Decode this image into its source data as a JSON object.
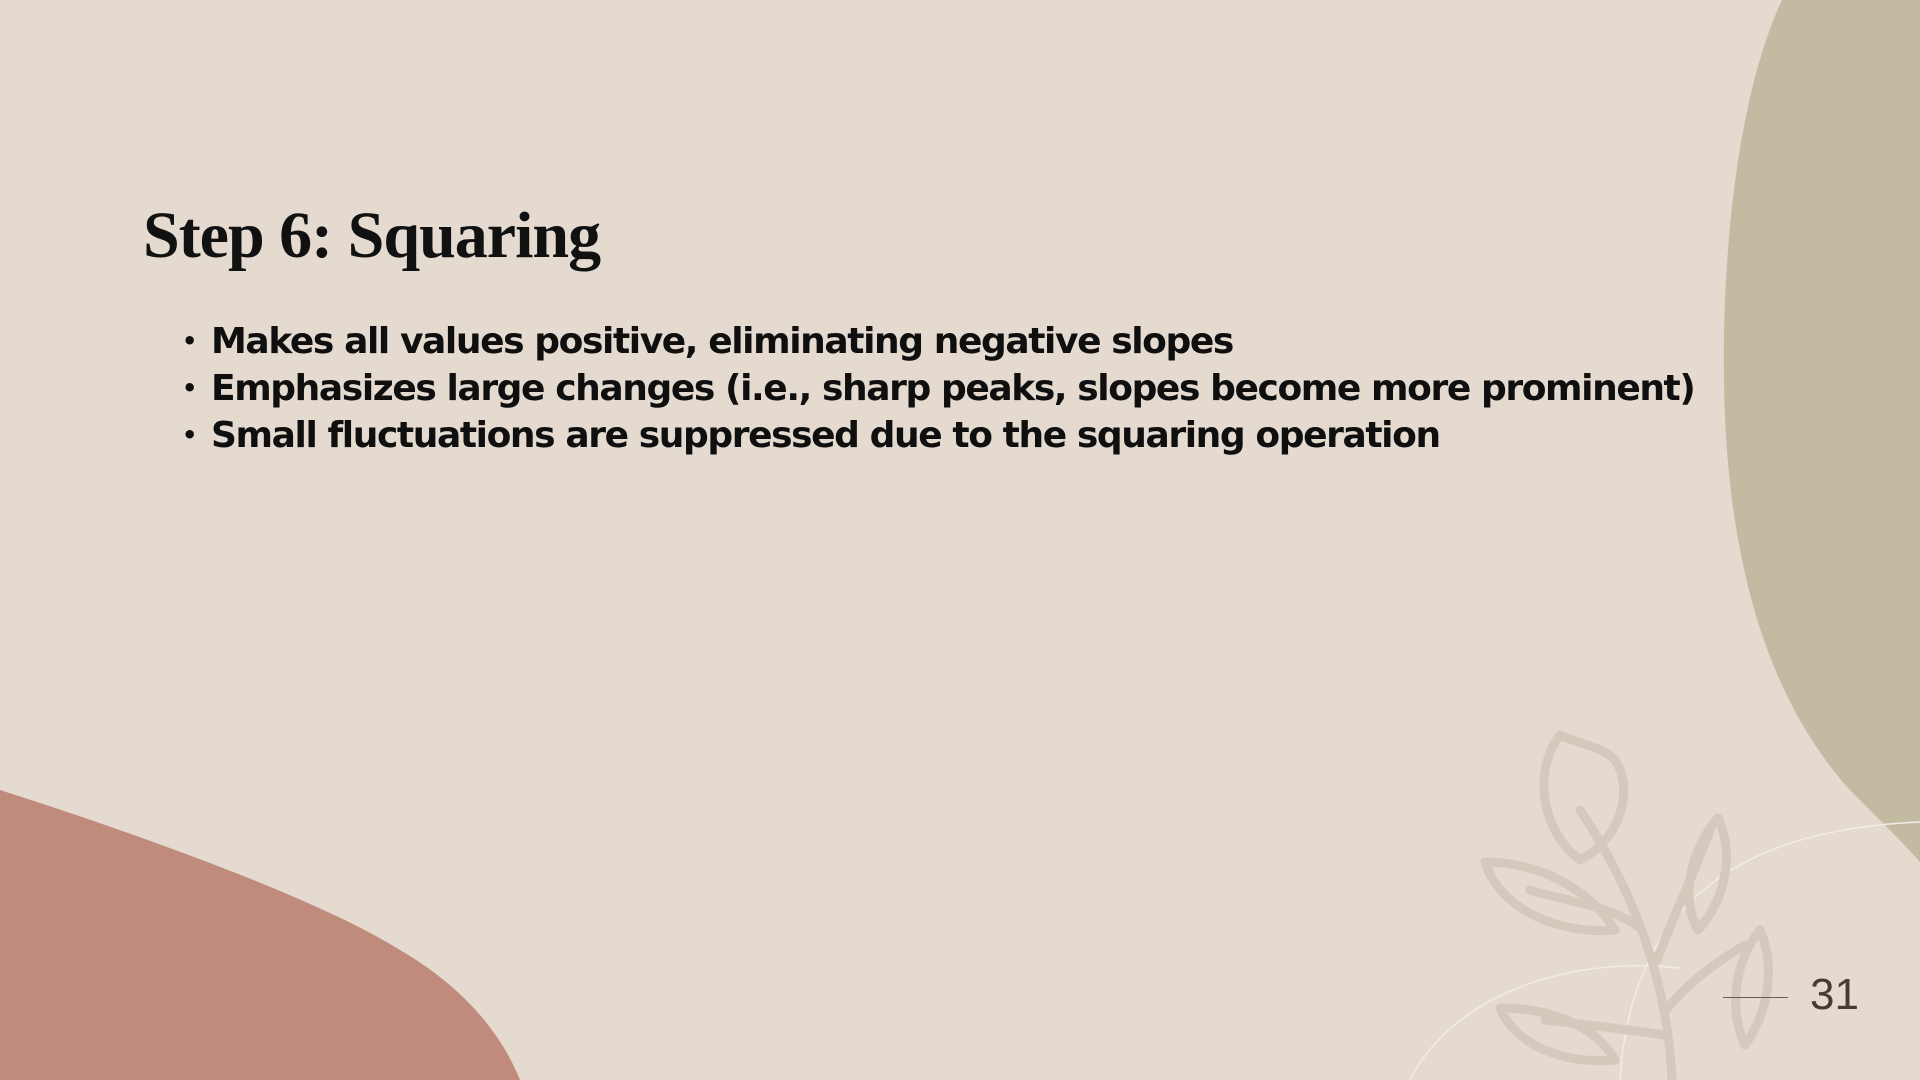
{
  "slide": {
    "title": "Step 6: Squaring",
    "bullets": [
      "Makes all values positive, eliminating negative slopes",
      "Emphasizes large changes (i.e., sharp peaks, slopes become more prominent)",
      "Small fluctuations are suppressed due to the squaring operation"
    ],
    "bullet_glyph": "•",
    "page_number": "31"
  },
  "colors": {
    "background": "#e4dad0",
    "olive_shape": "#c2bba2",
    "terracotta_shape": "#c08b7c",
    "leaf_outline": "#d3c9bc",
    "title_text": "#111111",
    "page_number": "#4a3a32"
  },
  "decor": {
    "icons": [
      "leaf-branch-icon"
    ]
  }
}
